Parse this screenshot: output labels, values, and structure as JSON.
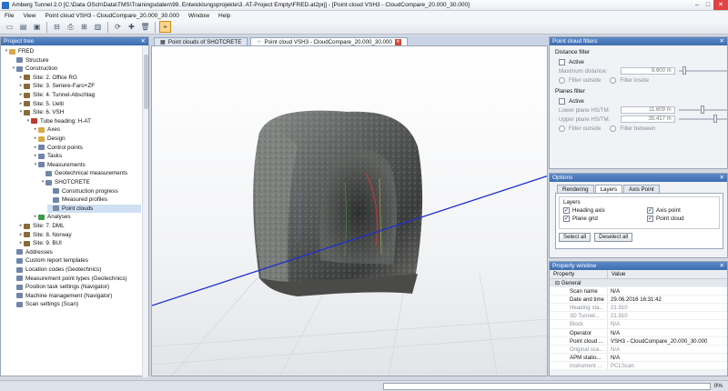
{
  "window": {
    "title": "Amberg Tunnel 2.0 [C:\\Data OSch\\Data\\TMS\\Trainingsdaten\\99. Entwicklungsprojekte\\3. AT-Project Empty\\FRED.at2prj] - [Point cloud VSH3 - CloudCompare_20.000_30.000]"
  },
  "menu": [
    "File",
    "View",
    "Point cloud VSH3 - CloudCompare_20.000_30.000",
    "Window",
    "Help"
  ],
  "project_tree": {
    "header": "Project tree",
    "items": [
      {
        "label": "FRED",
        "indent": 0,
        "arrow": "▾",
        "icon": "project-icon"
      },
      {
        "label": "Structure",
        "indent": 1,
        "arrow": "",
        "icon": "structure-icon"
      },
      {
        "label": "Construction",
        "indent": 1,
        "arrow": "▾",
        "icon": "construction-icon"
      },
      {
        "label": "Site: 2. Office RG",
        "indent": 2,
        "arrow": "▸",
        "icon": "site-icon"
      },
      {
        "label": "Site: 3. Seriere-Faro+ZF",
        "indent": 2,
        "arrow": "▸",
        "icon": "site-icon"
      },
      {
        "label": "Site: 4. Tunnel-Abschlag",
        "indent": 2,
        "arrow": "▸",
        "icon": "site-icon"
      },
      {
        "label": "Site: 5. Uelti",
        "indent": 2,
        "arrow": "▸",
        "icon": "site-icon"
      },
      {
        "label": "Site: 6. VSH",
        "indent": 2,
        "arrow": "▾",
        "icon": "site-icon"
      },
      {
        "label": "Tube heading: H-AT",
        "indent": 3,
        "arrow": "▾",
        "icon": "tube-icon"
      },
      {
        "label": "Axes",
        "indent": 4,
        "arrow": "▸",
        "icon": "folder-icon"
      },
      {
        "label": "Design",
        "indent": 4,
        "arrow": "▸",
        "icon": "folder-icon"
      },
      {
        "label": "Control points",
        "indent": 4,
        "arrow": "▸",
        "icon": "control-points-icon"
      },
      {
        "label": "Tasks",
        "indent": 4,
        "arrow": "▸",
        "icon": "tasks-icon"
      },
      {
        "label": "Measurements",
        "indent": 4,
        "arrow": "▾",
        "icon": "measurements-icon"
      },
      {
        "label": "Geotechnical measurements",
        "indent": 5,
        "arrow": "",
        "icon": "geotech-icon"
      },
      {
        "label": "SHOTCRETE",
        "indent": 5,
        "arrow": "▾",
        "icon": "shotcrete-icon"
      },
      {
        "label": "Construction progress",
        "indent": 6,
        "arrow": "",
        "icon": "progress-icon"
      },
      {
        "label": "Measured profiles",
        "indent": 6,
        "arrow": "",
        "icon": "profiles-icon"
      },
      {
        "label": "Point clouds",
        "indent": 6,
        "arrow": "",
        "icon": "point-cloud-icon",
        "selected": true
      },
      {
        "label": "Analyses",
        "indent": 4,
        "arrow": "▸",
        "icon": "analyses-icon"
      },
      {
        "label": "Site: 7. DML",
        "indent": 2,
        "arrow": "▸",
        "icon": "site-icon"
      },
      {
        "label": "Site: 8. Norway",
        "indent": 2,
        "arrow": "▸",
        "icon": "site-icon"
      },
      {
        "label": "Site: 9. BUI",
        "indent": 2,
        "arrow": "▸",
        "icon": "site-icon"
      },
      {
        "label": "Addresses",
        "indent": 1,
        "arrow": "",
        "icon": "addresses-icon"
      },
      {
        "label": "Custom report templates",
        "indent": 1,
        "arrow": "",
        "icon": "report-icon"
      },
      {
        "label": "Location codes (Geotechnics)",
        "indent": 1,
        "arrow": "",
        "icon": "location-icon"
      },
      {
        "label": "Measurement point types (Geotechnics)",
        "indent": 1,
        "arrow": "",
        "icon": "point-types-icon"
      },
      {
        "label": "Position task settings (Navigator)",
        "indent": 1,
        "arrow": "",
        "icon": "position-icon"
      },
      {
        "label": "Machine management (Navigator)",
        "indent": 1,
        "arrow": "",
        "icon": "machine-icon"
      },
      {
        "label": "Scan settings (Scan)",
        "indent": 1,
        "arrow": "",
        "icon": "scan-icon"
      }
    ]
  },
  "tabs": [
    {
      "label": "Point clouds of SHOTCRETE",
      "active": false
    },
    {
      "label": "Point cloud VSH3 - CloudCompare_20.000_30.000",
      "active": true
    }
  ],
  "point_cloud_filters": {
    "header": "Point cloud filters",
    "distance": {
      "title": "Distance filter",
      "active_label": "Active",
      "max_label": "Maximum distance:",
      "max_value": "8.600 m",
      "outside_label": "Filter outside",
      "inside_label": "Filter inside"
    },
    "planes": {
      "title": "Planes filter",
      "active_label": "Active",
      "lower_label": "Lower plane HS/TM:",
      "lower_value": "11.609 m",
      "upper_label": "Upper plane HS/TM:",
      "upper_value": "35.417 m",
      "outside_label": "Filter outside",
      "between_label": "Filter between"
    }
  },
  "options": {
    "header": "Options",
    "tabs": [
      "Rendering",
      "Layers",
      "Axis Point"
    ],
    "group_title": "Layers",
    "checks": [
      "Heading axis",
      "Axis point",
      "Plane grid",
      "Point cloud"
    ],
    "select_all": "Select all",
    "deselect_all": "Deselect all"
  },
  "property_window": {
    "header": "Property window",
    "col_property": "Property",
    "col_value": "Value",
    "group": "General",
    "rows": [
      {
        "k": "Scan name",
        "v": "N/A",
        "dim": false
      },
      {
        "k": "Date and time",
        "v": "29.06.2016 16:31:42",
        "dim": false
      },
      {
        "k": "Heading sta...",
        "v": "21.910",
        "dim": true
      },
      {
        "k": "3D Tunnel...",
        "v": "21.910",
        "dim": true
      },
      {
        "k": "Block",
        "v": "N/A",
        "dim": true
      },
      {
        "k": "Operator",
        "v": "N/A",
        "dim": false
      },
      {
        "k": "Point cloud ...",
        "v": "VSH3 - CloudCompare_20.000_30.000",
        "dim": false
      },
      {
        "k": "Original sca...",
        "v": "N/A",
        "dim": true
      },
      {
        "k": "APM statio...",
        "v": "N/A",
        "dim": false
      },
      {
        "k": "Instrument ...",
        "v": "PCLScan",
        "dim": true
      }
    ]
  },
  "status": {
    "progress_text": "0%",
    "progress": 0
  },
  "colors": {
    "header_blue": "#3e6db0",
    "axis_line": "#1f2fd0",
    "close_red": "#e04343"
  }
}
